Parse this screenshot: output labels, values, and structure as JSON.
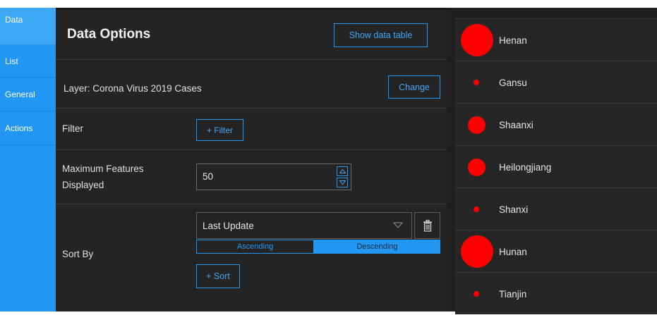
{
  "tabs": [
    {
      "label": "Data"
    },
    {
      "label": "List"
    },
    {
      "label": "General"
    },
    {
      "label": "Actions"
    }
  ],
  "panel": {
    "title": "Data Options",
    "show_table_label": "Show data table",
    "layer_text": "Layer: Corona Virus 2019 Cases",
    "change_label": "Change",
    "filter_label": "Filter",
    "add_filter_label": "+ Filter",
    "max_features_label_line1": "Maximum Features",
    "max_features_label_line2": "Displayed",
    "max_features_value": "50",
    "sort_by_label": "Sort By",
    "sort_field": "Last Update",
    "ascending_label": "Ascending",
    "descending_label": "Descending",
    "selected_order": "Descending",
    "add_sort_label": "+ Sort"
  },
  "list": {
    "items": [
      {
        "name": "Henan",
        "marker": "large"
      },
      {
        "name": "Gansu",
        "marker": "small"
      },
      {
        "name": "Shaanxi",
        "marker": "medium"
      },
      {
        "name": "Heilongjiang",
        "marker": "medium"
      },
      {
        "name": "Shanxi",
        "marker": "small"
      },
      {
        "name": "Hunan",
        "marker": "large"
      },
      {
        "name": "Tianjin",
        "marker": "small"
      }
    ]
  },
  "colors": {
    "accent": "#2196f3",
    "marker": "#ff0000",
    "panel_bg": "#242424"
  },
  "icons": {
    "select_arrow": "chevron-down-icon",
    "remove_sort": "trash-icon",
    "spin_up": "caret-up-icon",
    "spin_down": "caret-down-icon"
  }
}
